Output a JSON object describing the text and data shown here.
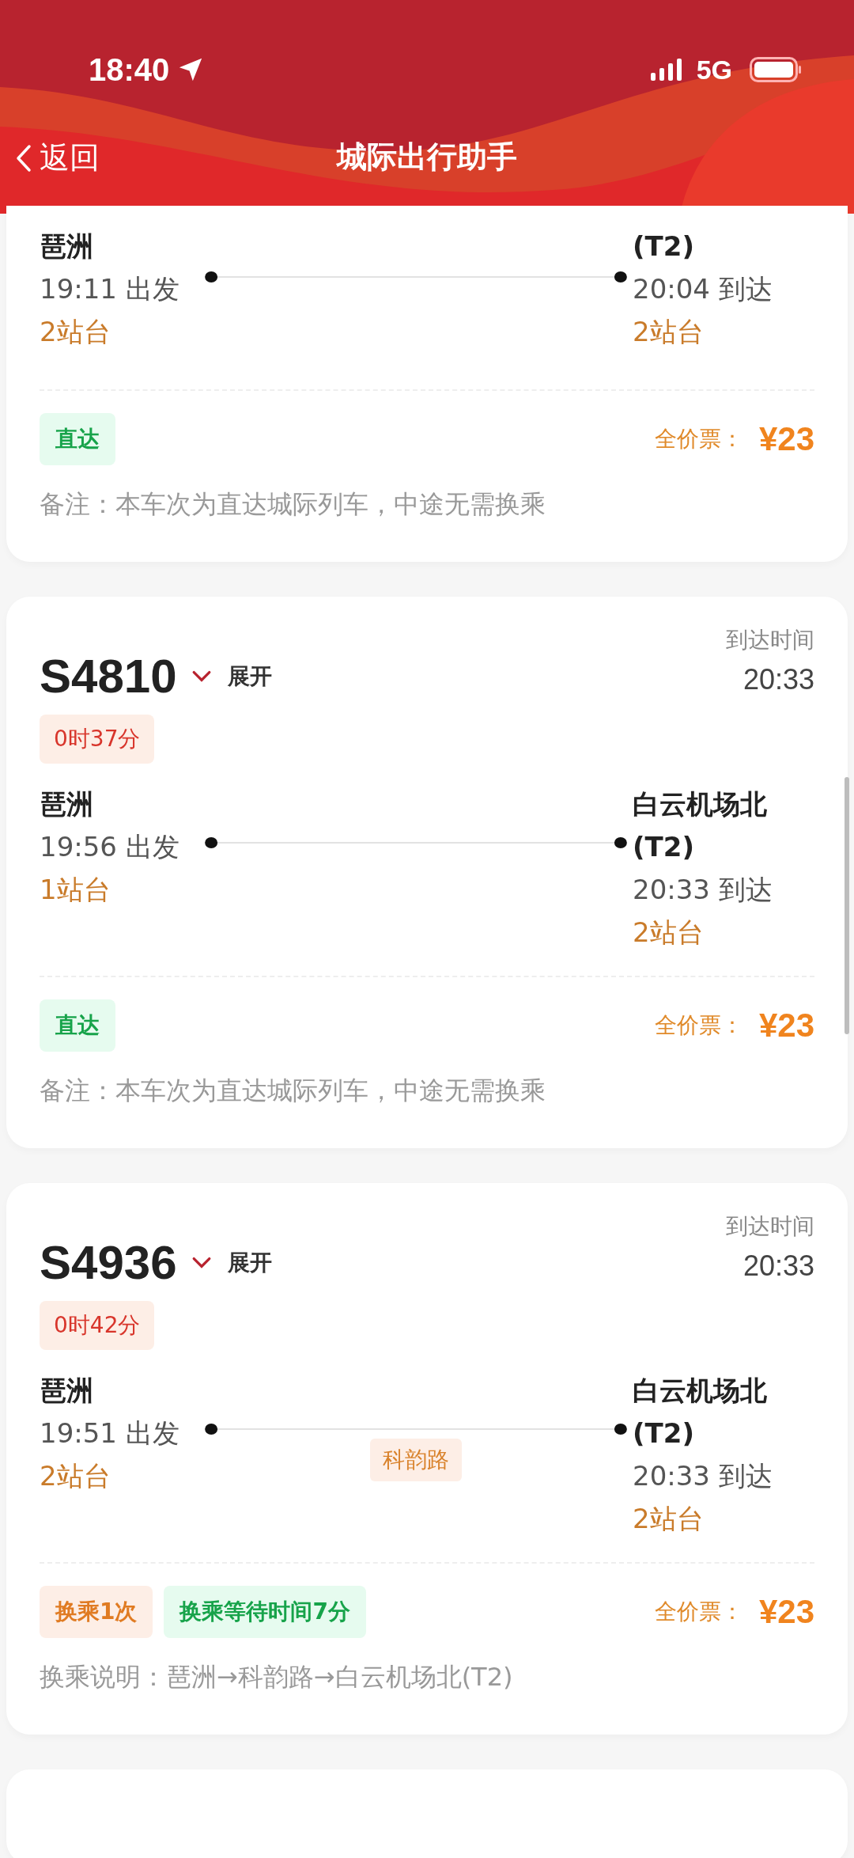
{
  "status_bar": {
    "time": "18:40",
    "network": "5G"
  },
  "nav": {
    "back": "返回",
    "title": "城际出行助手"
  },
  "trains": [
    {
      "from": {
        "station": "琶洲",
        "time": "19:11 出发",
        "platform": "2站台"
      },
      "to": {
        "station_lines": [
          "(T2)"
        ],
        "time": "20:04 到达",
        "platform": "2站台"
      },
      "tags": [
        {
          "kind": "direct",
          "text": "直达"
        }
      ],
      "price_label": "全价票：",
      "price": "¥23",
      "note": "备注：本车次为直达城际列车，中途无需换乘"
    },
    {
      "number": "S4810",
      "expand": "展开",
      "arrival_label": "到达时间",
      "arrival_time": "20:33",
      "duration": "0时37分",
      "from": {
        "station": "琶洲",
        "time": "19:56 出发",
        "platform": "1站台"
      },
      "to": {
        "station_lines": [
          "白云机场北",
          "(T2)"
        ],
        "time": "20:33 到达",
        "platform": "2站台"
      },
      "tags": [
        {
          "kind": "direct",
          "text": "直达"
        }
      ],
      "price_label": "全价票：",
      "price": "¥23",
      "note": "备注：本车次为直达城际列车，中途无需换乘"
    },
    {
      "number": "S4936",
      "expand": "展开",
      "arrival_label": "到达时间",
      "arrival_time": "20:33",
      "duration": "0时42分",
      "from": {
        "station": "琶洲",
        "time": "19:51 出发",
        "platform": "2站台"
      },
      "via": "科韵路",
      "to": {
        "station_lines": [
          "白云机场北",
          "(T2)"
        ],
        "time": "20:33 到达",
        "platform": "2站台"
      },
      "tags": [
        {
          "kind": "transfer",
          "text": "换乘1次"
        },
        {
          "kind": "direct",
          "text": "换乘等待时间7分"
        }
      ],
      "price_label": "全价票：",
      "price": "¥23",
      "note": "换乘说明：琶洲→科韵路→白云机场北(T2)"
    }
  ]
}
